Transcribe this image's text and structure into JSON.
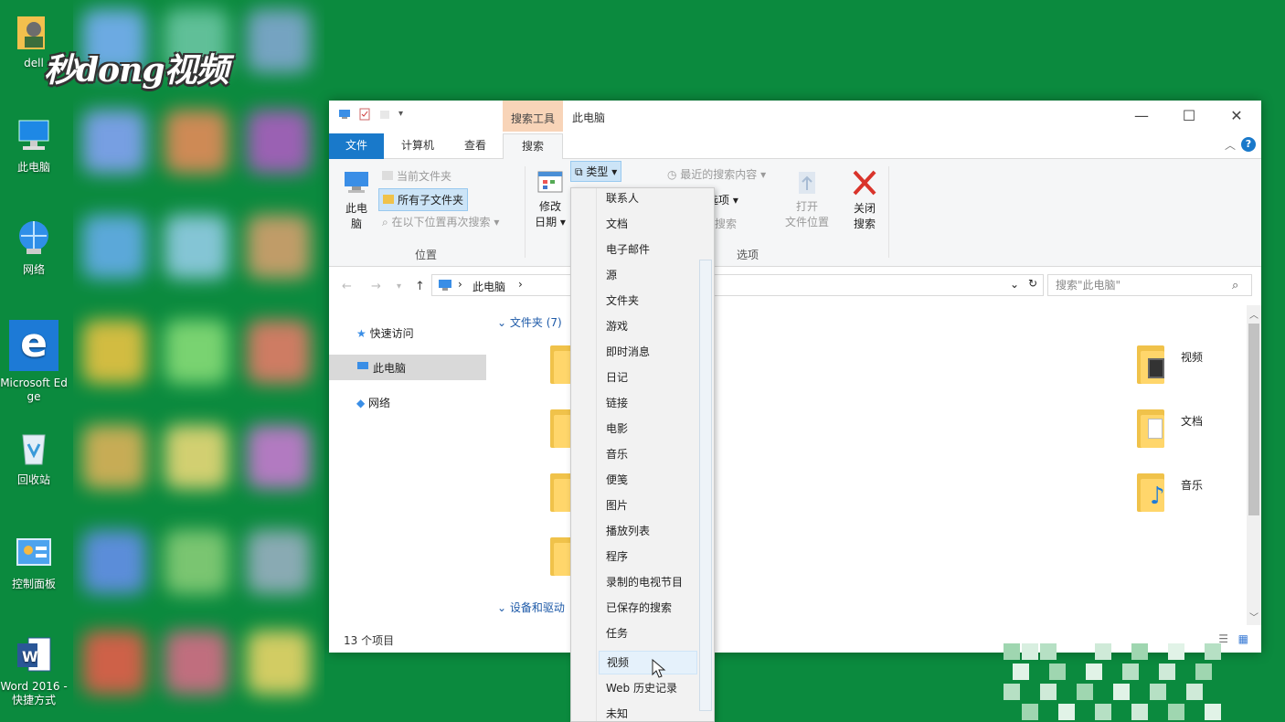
{
  "desktop": {
    "watermark": "秒dong视频",
    "icons": [
      {
        "label": "dell"
      },
      {
        "label": "此电脑"
      },
      {
        "label": "网络"
      },
      {
        "label": "Microsoft Edge"
      },
      {
        "label": "回收站"
      },
      {
        "label": "控制面板"
      },
      {
        "label": "Word 2016 - 快捷方式"
      }
    ]
  },
  "window": {
    "context_tab": "搜索工具",
    "title": "此电脑",
    "controls": {
      "minimize": "—",
      "maximize": "☐",
      "close": "✕"
    },
    "tabs": {
      "file": "文件",
      "computer": "计算机",
      "view": "查看",
      "search": "搜索"
    },
    "help": "?"
  },
  "ribbon": {
    "this_pc_1": "此电",
    "this_pc_2": "脑",
    "current_folder": "当前文件夹",
    "all_subfolders": "所有子文件夹",
    "search_again": "在以下位置再次搜索",
    "location_group": "位置",
    "modified_1": "修改",
    "modified_2": "日期",
    "type_button": "类型",
    "recent_searches": "最近的搜索内容",
    "advanced_frag": "选项",
    "saved_frag": "搜索",
    "open_file_location_1": "打开",
    "open_file_location_2": "文件位置",
    "close_search_1": "关闭",
    "close_search_2": "搜索",
    "options_group": "选项"
  },
  "address": {
    "path": "此电脑",
    "search_placeholder": "搜索\"此电脑\""
  },
  "nav": {
    "quick_access": "快速访问",
    "this_pc": "此电脑",
    "network": "网络"
  },
  "content": {
    "folders_header": "文件夹 (7)",
    "devices_header": "设备和驱动",
    "folders": [
      "视频",
      "文档",
      "音乐"
    ]
  },
  "status": {
    "count": "13 个项目"
  },
  "type_menu": {
    "items": [
      "联系人",
      "文档",
      "电子邮件",
      "源",
      "文件夹",
      "游戏",
      "即时消息",
      "日记",
      "链接",
      "电影",
      "音乐",
      "便笺",
      "图片",
      "播放列表",
      "程序",
      "录制的电视节目",
      "已保存的搜索",
      "任务",
      "视频",
      "Web 历史记录",
      "未知"
    ],
    "highlighted": "视频"
  },
  "colors": {
    "desktop_bg": "#0b8a3e",
    "accent": "#1979ca",
    "context_tab": "#f8d4b8"
  }
}
